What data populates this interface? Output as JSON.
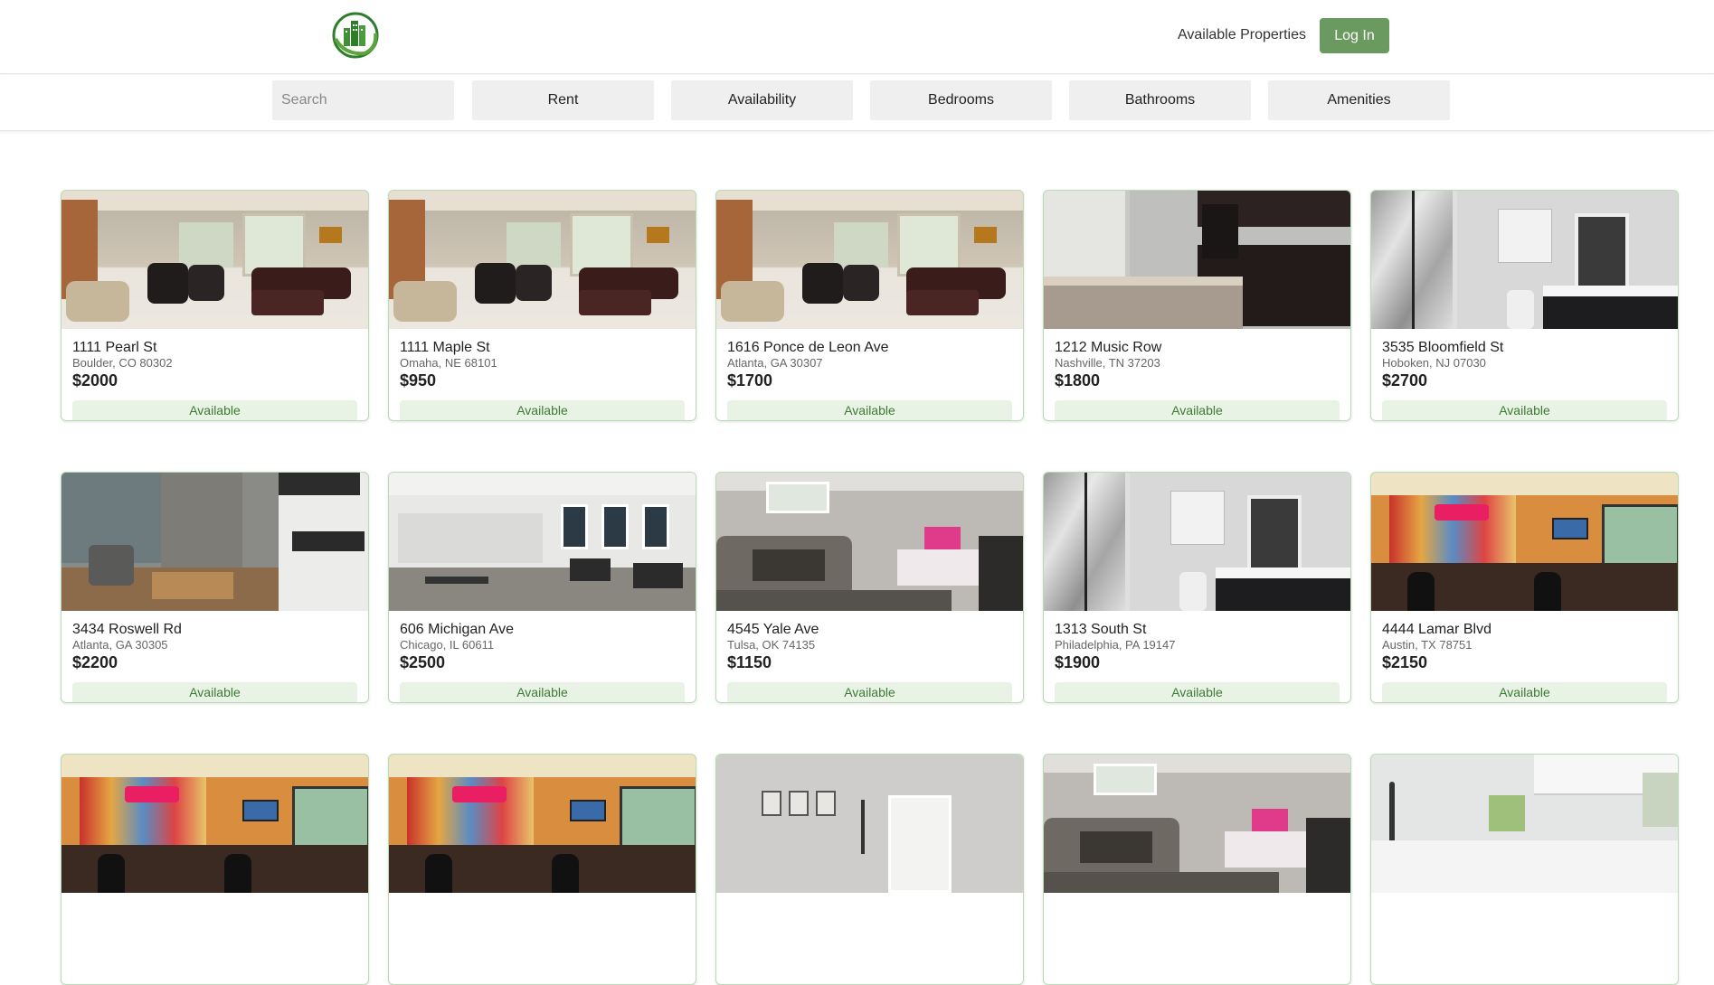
{
  "header": {
    "logo_name": "building-logo",
    "nav_link": "Available Properties",
    "login_label": "Log In"
  },
  "filters": {
    "search_placeholder": "Search",
    "buttons": [
      "Rent",
      "Availability",
      "Bedrooms",
      "Bathrooms",
      "Amenities"
    ]
  },
  "listings": [
    {
      "address": "1111 Pearl St",
      "city": "Boulder, CO 80302",
      "price": "$2000",
      "status": "Available",
      "scene": "living"
    },
    {
      "address": "1111 Maple St",
      "city": "Omaha, NE 68101",
      "price": "$950",
      "status": "Available",
      "scene": "living"
    },
    {
      "address": "1616 Ponce de Leon Ave",
      "city": "Atlanta, GA 30307",
      "price": "$1700",
      "status": "Available",
      "scene": "living"
    },
    {
      "address": "1212 Music Row",
      "city": "Nashville, TN 37203",
      "price": "$1800",
      "status": "Available",
      "scene": "kitchen"
    },
    {
      "address": "3535 Bloomfield St",
      "city": "Hoboken, NJ 07030",
      "price": "$2700",
      "status": "Available",
      "scene": "bath"
    },
    {
      "address": "3434 Roswell Rd",
      "city": "Atlanta, GA 30305",
      "price": "$2200",
      "status": "Available",
      "scene": "patio"
    },
    {
      "address": "606 Michigan Ave",
      "city": "Chicago, IL 60611",
      "price": "$2500",
      "status": "Available",
      "scene": "gym"
    },
    {
      "address": "4545 Yale Ave",
      "city": "Tulsa, OK 74135",
      "price": "$1150",
      "status": "Available",
      "scene": "basement"
    },
    {
      "address": "1313 South St",
      "city": "Philadelphia, PA 19147",
      "price": "$1900",
      "status": "Available",
      "scene": "bath"
    },
    {
      "address": "4444 Lamar Blvd",
      "city": "Austin, TX 78751",
      "price": "$2150",
      "status": "Available",
      "scene": "bar"
    },
    {
      "address": "",
      "city": "",
      "price": "",
      "status": "",
      "scene": "bar"
    },
    {
      "address": "",
      "city": "",
      "price": "",
      "status": "",
      "scene": "bar"
    },
    {
      "address": "",
      "city": "",
      "price": "",
      "status": "",
      "scene": "frames"
    },
    {
      "address": "",
      "city": "",
      "price": "",
      "status": "",
      "scene": "basement"
    },
    {
      "address": "",
      "city": "",
      "price": "",
      "status": "",
      "scene": "whitekitchen"
    }
  ],
  "colors": {
    "accent": "#6a9a5f",
    "badge_bg": "#e8f3e6",
    "badge_text": "#3d7a32",
    "card_border": "#b9dcb6"
  }
}
